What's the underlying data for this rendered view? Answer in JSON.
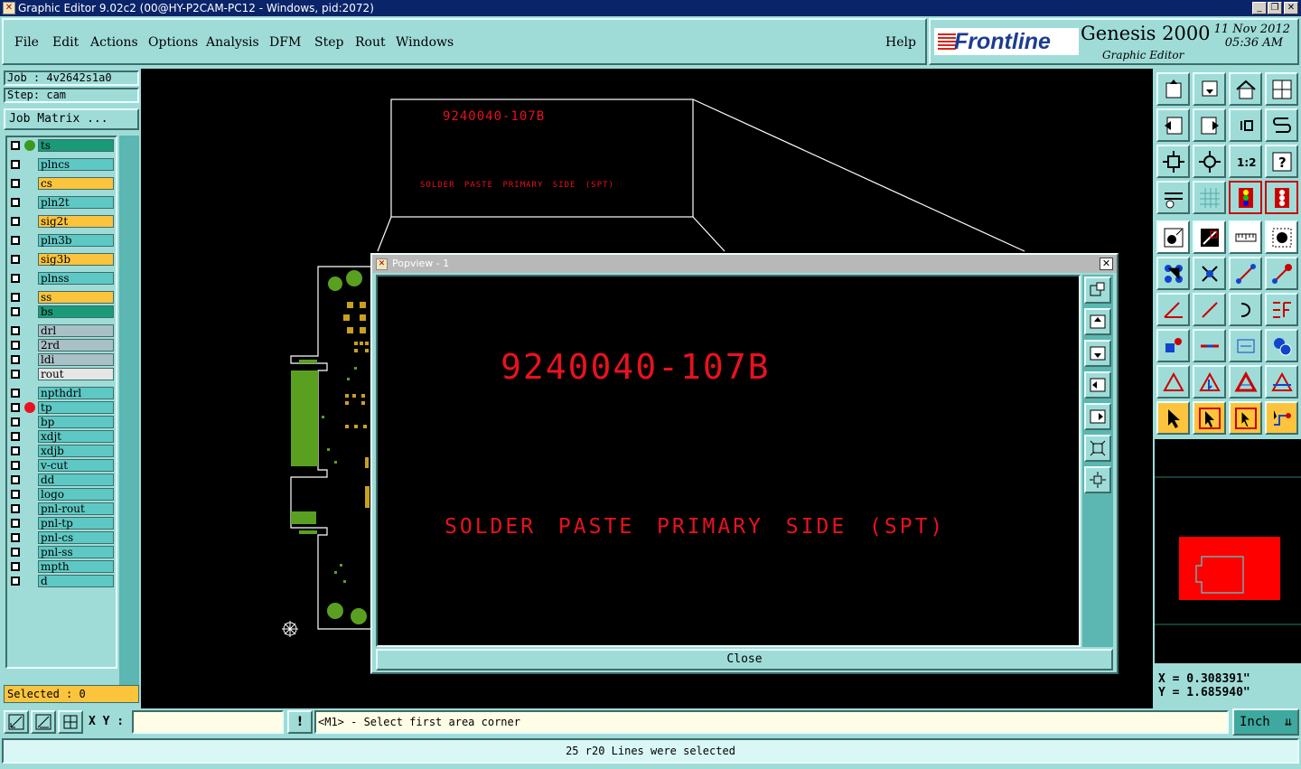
{
  "window": {
    "title": "Graphic Editor 9.02c2 (00@HY-P2CAM-PC12 - Windows, pid:2072)",
    "buttons": [
      "_",
      "❐",
      "✕"
    ]
  },
  "menu": {
    "items": [
      "File",
      "Edit",
      "Actions",
      "Options",
      "Analysis",
      "DFM",
      "Step",
      "Rout",
      "Windows"
    ],
    "help": "Help"
  },
  "brand": {
    "logo_text": "Frontline",
    "product": "Genesis 2000",
    "subtitle": "Graphic Editor",
    "date": "11 Nov 2012",
    "time": "05:36 AM"
  },
  "job": {
    "job_label": "Job : 4v2642s1a0",
    "step_label": "Step: cam",
    "matrix_button": "Job Matrix ..."
  },
  "layers": [
    {
      "name": "ts",
      "color": "#1a9a78",
      "dot": "#3a9a20"
    },
    {
      "name": "plncs",
      "color": "#5ec8c4",
      "dot": ""
    },
    {
      "name": "cs",
      "color": "#fcc43c",
      "dot": ""
    },
    {
      "name": "pln2t",
      "color": "#5ec8c4",
      "dot": ""
    },
    {
      "name": "sig2t",
      "color": "#fcc43c",
      "dot": ""
    },
    {
      "name": "pln3b",
      "color": "#5ec8c4",
      "dot": ""
    },
    {
      "name": "sig3b",
      "color": "#fcc43c",
      "dot": ""
    },
    {
      "name": "plnss",
      "color": "#5ec8c4",
      "dot": ""
    },
    {
      "name": "ss",
      "color": "#fcc43c",
      "dot": ""
    },
    {
      "name": "bs",
      "color": "#1a9a78",
      "dot": ""
    },
    {
      "name": "drl",
      "color": "#a9c0c6",
      "dot": ""
    },
    {
      "name": "2rd",
      "color": "#a9c0c6",
      "dot": ""
    },
    {
      "name": "ldi",
      "color": "#a9c0c6",
      "dot": ""
    },
    {
      "name": "rout",
      "color": "#e6e6e6",
      "dot": ""
    },
    {
      "name": "npthdrl",
      "color": "#5ec8c4",
      "dot": ""
    },
    {
      "name": "tp",
      "color": "#5ec8c4",
      "dot": "#e8121e"
    },
    {
      "name": "bp",
      "color": "#5ec8c4",
      "dot": ""
    },
    {
      "name": "xdjt",
      "color": "#5ec8c4",
      "dot": ""
    },
    {
      "name": "xdjb",
      "color": "#5ec8c4",
      "dot": ""
    },
    {
      "name": "v-cut",
      "color": "#5ec8c4",
      "dot": ""
    },
    {
      "name": "dd",
      "color": "#5ec8c4",
      "dot": ""
    },
    {
      "name": "logo",
      "color": "#5ec8c4",
      "dot": ""
    },
    {
      "name": "pnl-rout",
      "color": "#5ec8c4",
      "dot": ""
    },
    {
      "name": "pnl-tp",
      "color": "#5ec8c4",
      "dot": ""
    },
    {
      "name": "pnl-cs",
      "color": "#5ec8c4",
      "dot": ""
    },
    {
      "name": "pnl-ss",
      "color": "#5ec8c4",
      "dot": ""
    },
    {
      "name": "mpth",
      "color": "#5ec8c4",
      "dot": ""
    },
    {
      "name": "d",
      "color": "#5ec8c4",
      "dot": ""
    }
  ],
  "selected_label": "Selected : 0",
  "canvas": {
    "part_number": "9240040-107B",
    "annotation": "SOLDER PASTE PRIMARY SIDE (SPT)"
  },
  "popview": {
    "title": "Popview - 1",
    "part_number": "9240040-107B",
    "annotation": "SOLDER PASTE PRIMARY SIDE (SPT)",
    "close_label": "Close",
    "close_x": "✕"
  },
  "coords": {
    "x": "X = 0.308391\"",
    "y": "Y = 1.685940\""
  },
  "bottom": {
    "xy_label": "X Y :",
    "xy_value": "",
    "warn_icon": "!",
    "prompt": "<M1> - Select first area corner",
    "units": "Inch"
  },
  "status": "25 r20 Lines were selected"
}
